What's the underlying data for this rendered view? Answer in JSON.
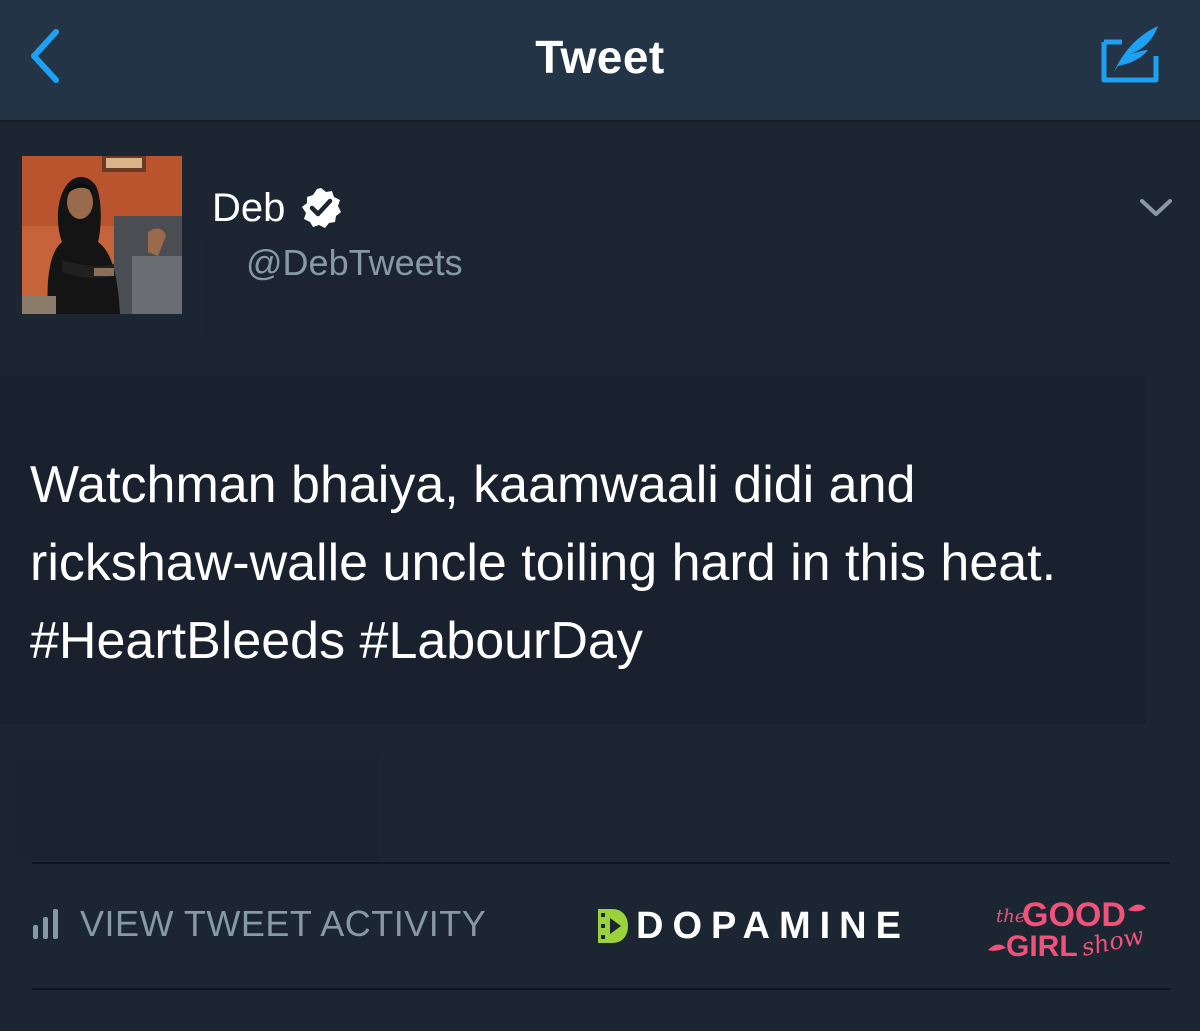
{
  "navbar": {
    "title": "Tweet",
    "back_icon": "chevron-left-icon",
    "compose_icon": "compose-tweet-icon",
    "accent_color": "#1da1f2"
  },
  "tweet": {
    "display_name": "Deb",
    "verified": true,
    "handle": "@DebTweets",
    "text": "Watchman bhaiya, kaamwaali didi and rickshaw-walle uncle toiling hard in this heat. #HeartBleeds #LabourDay"
  },
  "footer": {
    "activity_label": "VIEW TWEET ACTIVITY",
    "activity_icon": "bar-chart-icon",
    "dopamine_logo": "DOPAMINE",
    "dopamine_color": "#9bd13a",
    "goodgirl_logo": {
      "the": "the",
      "good": "GOOD",
      "girl": "GIRL",
      "show": "show",
      "color": "#f0527a"
    }
  }
}
